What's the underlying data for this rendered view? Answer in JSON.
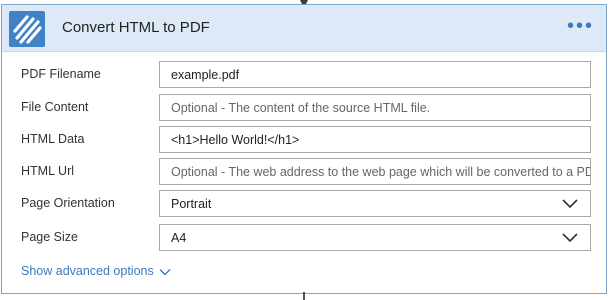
{
  "card": {
    "title": "Convert HTML to PDF",
    "more_label": "•••",
    "logo_icon": "diagonal-stripes-logo",
    "accent_color": "#3f82c5"
  },
  "fields": [
    {
      "label": "PDF Filename",
      "value": "example.pdf",
      "placeholder": ""
    },
    {
      "label": "File Content",
      "value": "",
      "placeholder": "Optional - The content of the source HTML file."
    },
    {
      "label": "HTML Data",
      "value": "<h1>Hello World!</h1>",
      "placeholder": ""
    },
    {
      "label": "HTML Url",
      "value": "",
      "placeholder": "Optional - The web address to the web page which will be converted to a PDF"
    },
    {
      "label": "Page Orientation",
      "value": "Portrait",
      "placeholder": ""
    },
    {
      "label": "Page Size",
      "value": "A4",
      "placeholder": ""
    }
  ],
  "advanced_label": "Show advanced options"
}
